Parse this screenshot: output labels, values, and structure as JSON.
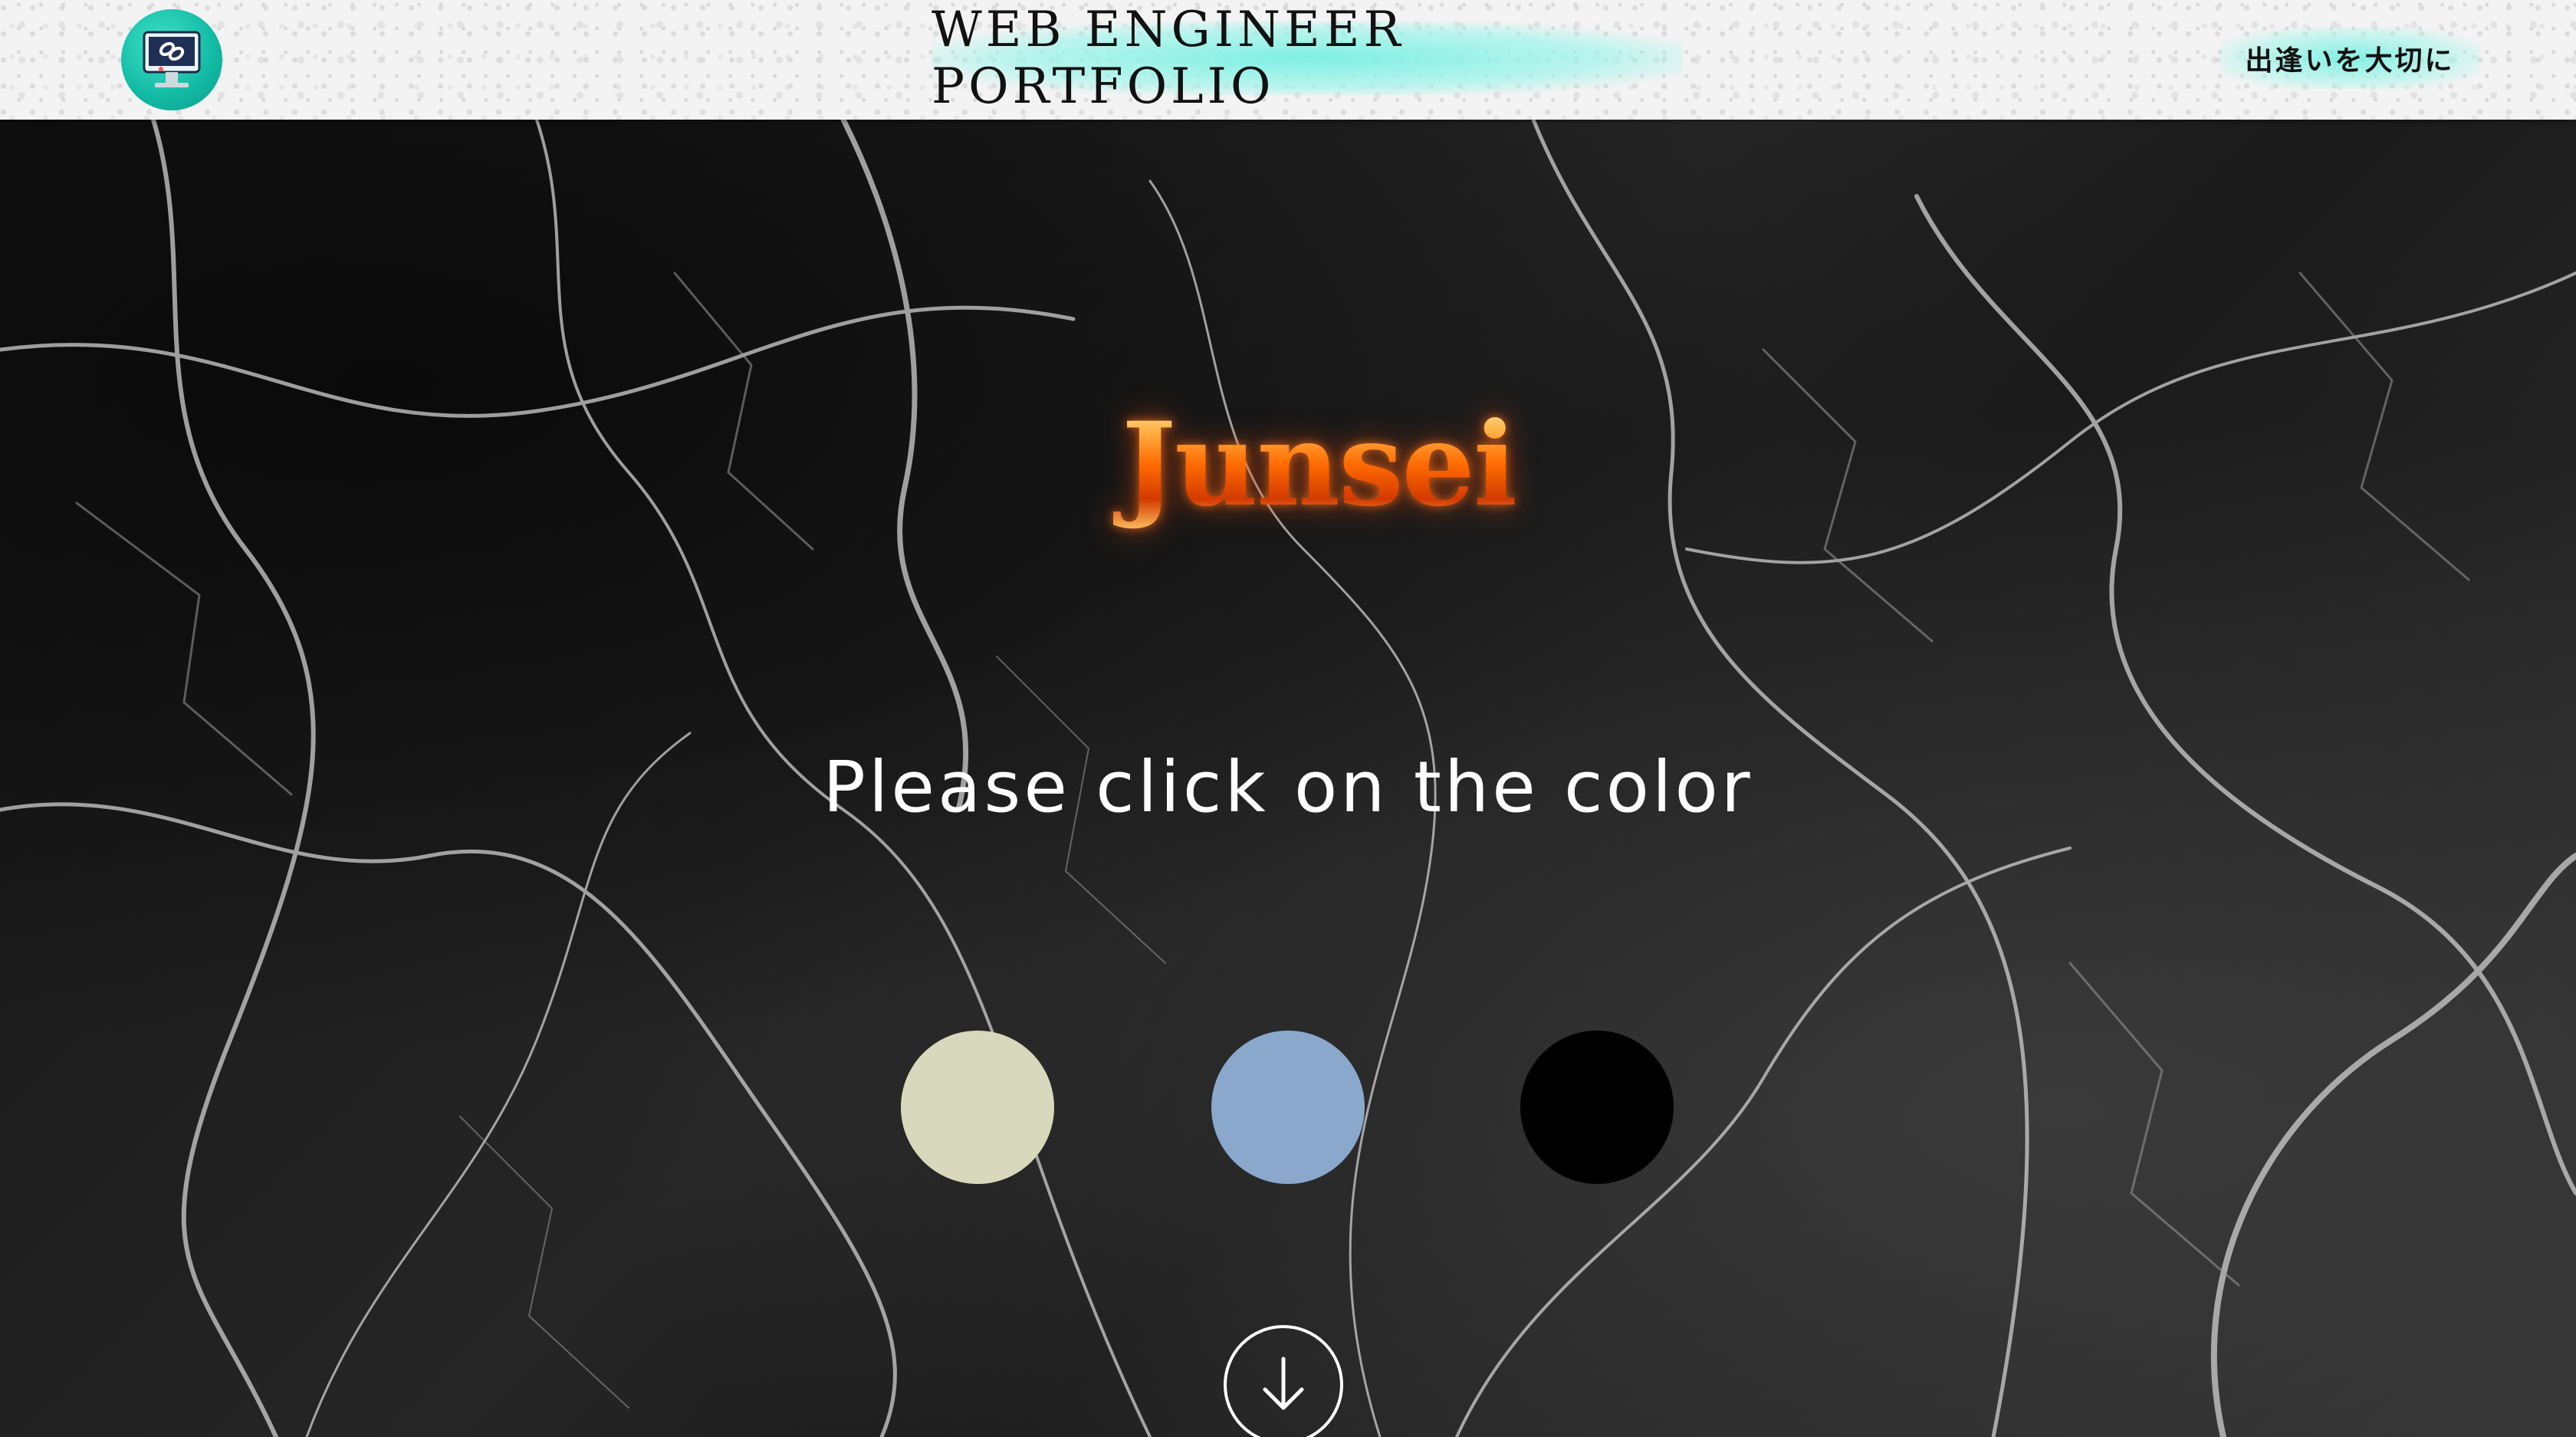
{
  "header": {
    "logo_icon": "computer-link-icon",
    "site_title": "WEB ENGINEER PORTFOLIO",
    "tagline": "出逢いを大切に",
    "accent_color": "#8ff0e3"
  },
  "hero": {
    "brand": "Junsei",
    "prompt": "Please click on the color",
    "swatches": [
      {
        "name": "beige",
        "color": "#d8d8bc"
      },
      {
        "name": "blue",
        "color": "#89a8cc"
      },
      {
        "name": "black",
        "color": "#000000"
      }
    ],
    "scroll_icon": "arrow-down-circle-icon"
  }
}
